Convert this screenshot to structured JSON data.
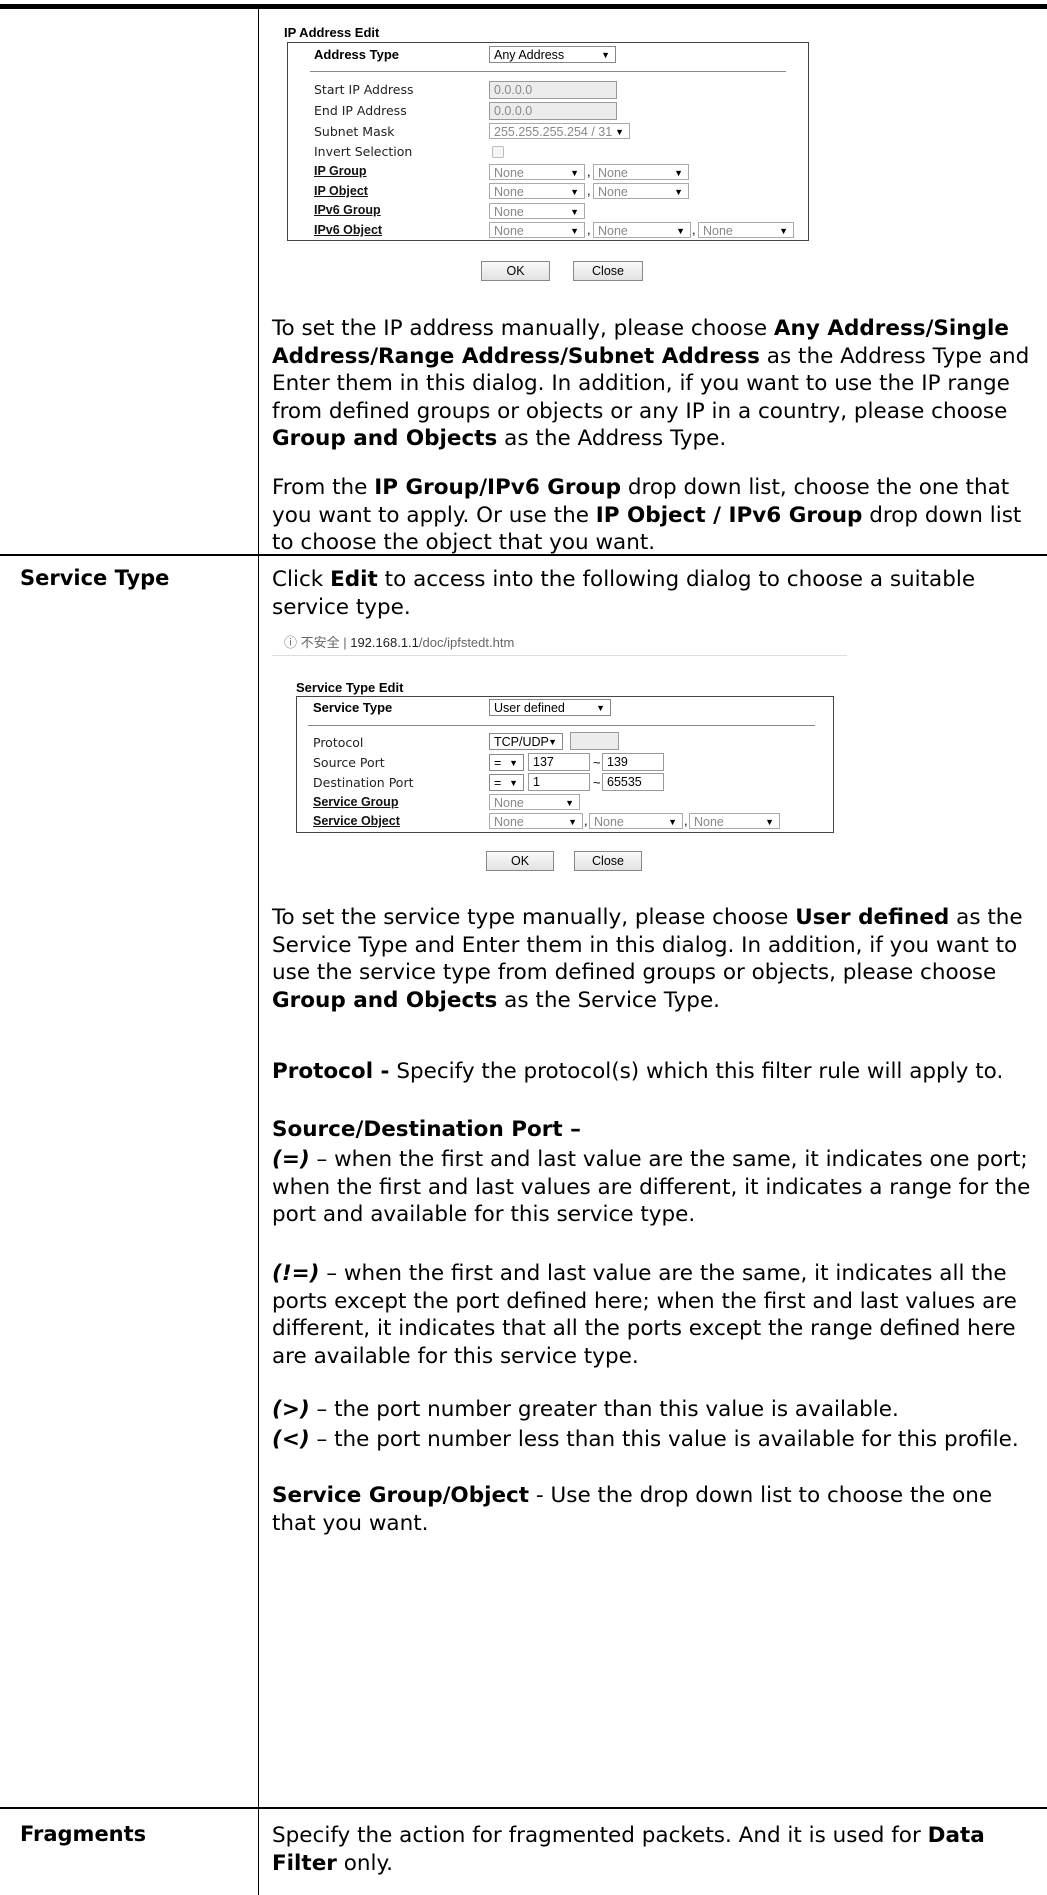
{
  "ip_dialog": {
    "title": "IP Address Edit",
    "address_type_label": "Address Type",
    "address_type_value": "Any Address",
    "start_ip_label": "Start IP Address",
    "start_ip_value": "0.0.0.0",
    "end_ip_label": "End IP Address",
    "end_ip_value": "0.0.0.0",
    "subnet_mask_label": "Subnet Mask",
    "subnet_mask_value": "255.255.255.254 / 31",
    "invert_label": "Invert Selection",
    "ip_group_label": "IP Group",
    "ip_object_label": "IP Object",
    "ipv6_group_label": "IPv6 Group",
    "ipv6_object_label": "IPv6 Object",
    "none": "None",
    "ok": "OK",
    "close": "Close"
  },
  "ip_para1": {
    "t1": "To set the IP address manually, please choose ",
    "b1": "Any Address/Single Address/Range Address/Subnet Address",
    "t2": " as the Address Type and Enter them in this dialog. In addition, if you want to use the IP range from defined groups or objects or any IP in a country, please choose ",
    "b2": "Group and Objects",
    "t3": " as the Address Type."
  },
  "ip_para2": {
    "t1": "From the ",
    "b1": "IP Group/IPv6 Group",
    "t2": " drop down list, choose the one that you want to apply. Or use the ",
    "b2": "IP Object / IPv6 Group",
    "t3": " drop down list to choose the object that you want."
  },
  "service_type": {
    "row_label": "Service Type",
    "intro_t1": "Click ",
    "intro_b1": "Edit",
    "intro_t2": " to access into the following dialog to choose a suitable service type.",
    "url_prefix": "ⓘ 不安全 | ",
    "url_host": "192.168.1.1",
    "url_path": "/doc/ipfstedt.htm"
  },
  "svc_dialog": {
    "title": "Service Type Edit",
    "service_type_label": "Service Type",
    "service_type_value": "User defined",
    "protocol_label": "Protocol",
    "protocol_value": "TCP/UDP",
    "source_port_label": "Source Port",
    "source_op": "=",
    "source_start": "137",
    "source_end": "139",
    "dest_port_label": "Destination Port",
    "dest_op": "=",
    "dest_start": "1",
    "dest_end": "65535",
    "tilde": "~",
    "service_group_label": "Service Group",
    "service_object_label": "Service Object",
    "none": "None",
    "ok": "OK",
    "close": "Close"
  },
  "svc_text": {
    "p1_t1": "To set the service type manually, please choose ",
    "p1_b1": "User defined",
    "p1_t2": " as the Service Type and Enter them in this dialog. In addition, if you want to use the service type from defined groups or objects, please choose ",
    "p1_b2": "Group and Objects",
    "p1_t3": " as the Service Type.",
    "p2_b": "Protocol -",
    "p2_t": " Specify the protocol(s) which this filter rule will apply to.",
    "p3_b": "Source/Destination Port –",
    "p4_i": "(=)",
    "p4_t": " – when the first and last value are the same, it indicates one port; when the first and last values are different, it indicates a range for the port and available for this service type.",
    "p5_i": "(!=)",
    "p5_t": " – when the first and last value are the same, it indicates all the ports except the port defined here; when the first and last values are different, it indicates that all the ports except the range defined here are available for this service type.",
    "p6_i": "(>)",
    "p6_t": " – the port number greater than this value is available.",
    "p7_i": "(<)",
    "p7_t": " – the port number less than this value is available for this profile.",
    "p8_b": "Service Group/Object",
    "p8_t": " - Use the drop down list to choose the one that you want."
  },
  "fragments": {
    "row_label": "Fragments",
    "t1": "Specify the action for fragmented packets. And it is used for ",
    "b1": "Data Filter",
    "t2": " only."
  }
}
